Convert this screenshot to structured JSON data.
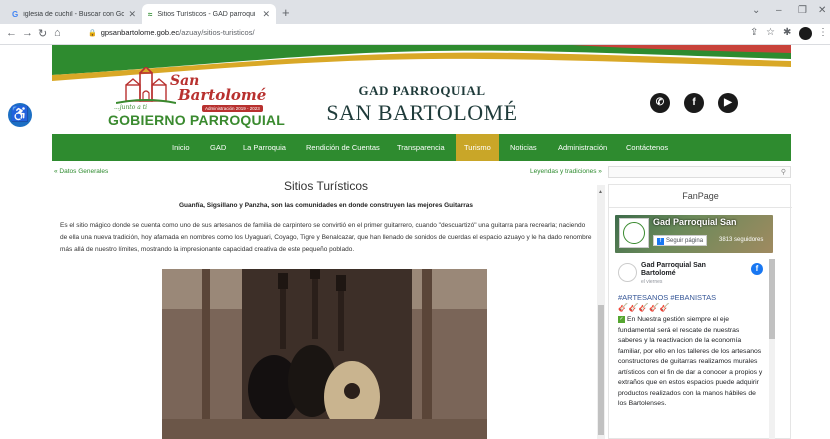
{
  "browser": {
    "tabs": [
      {
        "title": "iglesia de cuchil - Buscar con Go",
        "favicon": "G"
      },
      {
        "title": "Sitios Turísticos - GAD parroqui",
        "favicon": "≈"
      }
    ],
    "url_domain": "gpsanbartolome.gob.ec",
    "url_path": "/azuay/sitios-turisticos/"
  },
  "header": {
    "logo_script_top": "San",
    "logo_script_bottom": "Bartolomé",
    "logo_tagline": "...junto a ti",
    "logo_admin": "Administración 2019 - 2023",
    "logo_gob": "GOBIERNO PARROQUIAL",
    "title_line1": "GAD PARROQUIAL",
    "title_line2": "SAN BARTOLOMÉ"
  },
  "nav": {
    "items": [
      "Inicio",
      "GAD",
      "La Parroquia",
      "Rendición de Cuentas",
      "Transparencia",
      "Turismo",
      "Noticias",
      "Administración",
      "Contáctenos"
    ],
    "active": "Turismo"
  },
  "breadcrumbs": {
    "prev": "« Datos Generales",
    "next": "Leyendas y tradiciones »"
  },
  "main": {
    "title": "Sitios Turísticos",
    "subtitle": "Guanfía, Sigsillano y Panzha, son las comunidades en donde construyen las mejores Guitarras",
    "body": "Es el sitio mágico donde se cuenta como uno de sus artesanos de familia de carpintero se convirtió en el primer guitarrero, cuando \"descuartizó\" una guitarra para recrearla; naciendo de ella una nueva tradición, hoy afamada en nombres como los Uyaguari, Coyago, Tigre y Benalcazar, que han llenado de sonidos de cuerdas el espacio azuayo y le ha dado renombre más allá de nuestro límites, mostrando la impresionante capacidad creativa de este pequeño poblado."
  },
  "sidebar": {
    "search_placeholder": "",
    "title": "FanPage",
    "fb_page_name": "Gad Parroquial San",
    "fb_follow": "Seguir página",
    "fb_followers": "3813 seguidores",
    "post_name": "Gad Parroquial San Bartolomé",
    "post_when": "el viernes",
    "post_tags": "#ARTESANOS #EBANISTAS",
    "post_emojis": "🎸🎸🎸🎸🎸",
    "post_text": "En Nuestra gestión siempre el eje fundamental será el rescate de nuestras saberes y la reactivacion de la economía familiar, por ello en los talleres de los artesanos constructores de guitarras realizamos murales artísticos con el fin de dar a conocer a propios y extraños que en estos espacios puede adquirir productos realizados con la manos hábiles de los Bartolenses."
  },
  "colors": {
    "nav_green": "#2e8b2f",
    "active_gold": "#c9a628",
    "brand_red": "#b8312f"
  }
}
